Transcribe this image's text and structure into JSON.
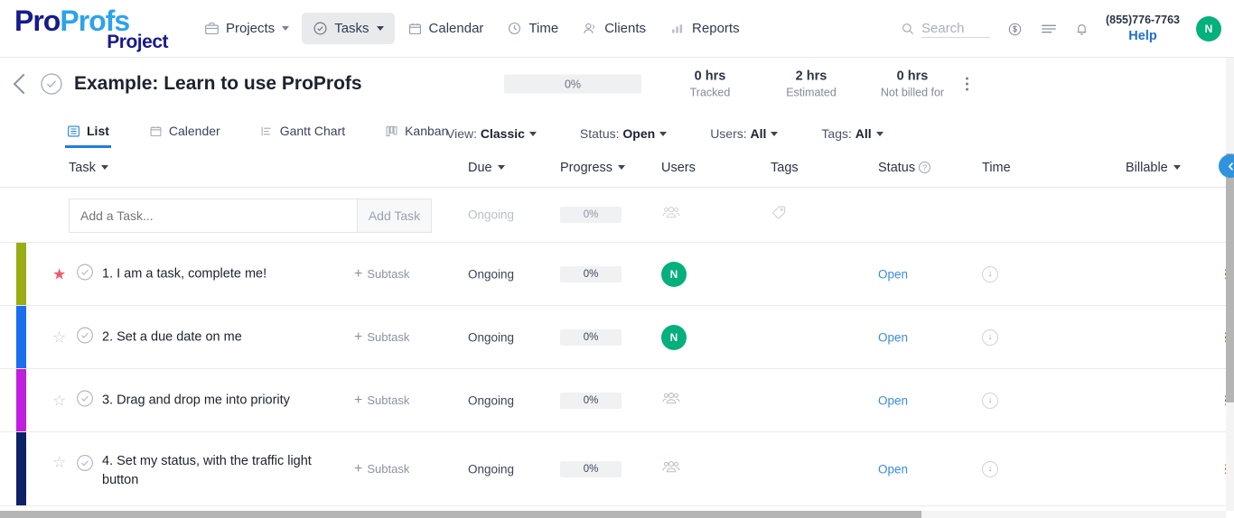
{
  "brand": {
    "logo_pro": "Pro",
    "logo_profs": "Profs",
    "logo_project": "Project",
    "accent_blue": "#2da3e8",
    "accent_navy": "#161b8c"
  },
  "topnav": {
    "items": [
      {
        "label": "Projects",
        "icon": "briefcase-icon",
        "has_caret": true,
        "active": false
      },
      {
        "label": "Tasks",
        "icon": "check-circle-icon",
        "has_caret": true,
        "active": true
      },
      {
        "label": "Calendar",
        "icon": "calendar-icon",
        "has_caret": false,
        "active": false
      },
      {
        "label": "Time",
        "icon": "clock-icon",
        "has_caret": false,
        "active": false
      },
      {
        "label": "Clients",
        "icon": "user-icon",
        "has_caret": false,
        "active": false
      },
      {
        "label": "Reports",
        "icon": "bar-chart-icon",
        "has_caret": false,
        "active": false
      }
    ],
    "search_placeholder": "Search",
    "billing_icon": "dollar-circle-icon",
    "menu_icon": "hamburger-icon",
    "bell_icon": "bell-icon",
    "help_phone": "(855)776-7763",
    "help_label": "Help",
    "avatar_initial": "N",
    "avatar_color": "#05b07c"
  },
  "project": {
    "back_icon": "back-chevron-icon",
    "status_icon": "check-circle-icon",
    "title": "Example: Learn to use ProProfs",
    "progress_label": "0%",
    "stats": [
      {
        "value": "0 hrs",
        "label": "Tracked"
      },
      {
        "value": "2 hrs",
        "label": "Estimated"
      },
      {
        "value": "0 hrs",
        "label": "Not billed for"
      }
    ],
    "more_icon": "kebab-menu-icon"
  },
  "view_tabs": [
    {
      "label": "List",
      "icon": "list-icon",
      "active": true
    },
    {
      "label": "Calender",
      "icon": "calendar-icon",
      "active": false
    },
    {
      "label": "Gantt Chart",
      "icon": "gantt-icon",
      "active": false
    },
    {
      "label": "Kanban",
      "icon": "kanban-icon",
      "active": false
    }
  ],
  "filters": [
    {
      "name": "View",
      "value": "Classic"
    },
    {
      "name": "Status",
      "value": "Open"
    },
    {
      "name": "Users",
      "value": "All"
    },
    {
      "name": "Tags",
      "value": "All"
    }
  ],
  "table": {
    "columns": [
      {
        "key": "task",
        "label": "Task",
        "sortable": true
      },
      {
        "key": "due",
        "label": "Due",
        "sortable": true
      },
      {
        "key": "progress",
        "label": "Progress",
        "sortable": true
      },
      {
        "key": "users",
        "label": "Users",
        "sortable": false
      },
      {
        "key": "tags",
        "label": "Tags",
        "sortable": false
      },
      {
        "key": "status",
        "label": "Status",
        "sortable": false,
        "help": true
      },
      {
        "key": "time",
        "label": "Time",
        "sortable": false
      },
      {
        "key": "billable",
        "label": "Billable",
        "sortable": true
      }
    ],
    "add_row": {
      "input_placeholder": "Add a Task...",
      "input_value": "",
      "button_label": "Add Task",
      "due": "Ongoing",
      "progress": "0%",
      "users_icon": "users-group-icon",
      "tags_icon": "tag-icon"
    },
    "rows": [
      {
        "bar_color": "#9aad14",
        "dot_color": "#7bcb18",
        "starred": true,
        "title": "1. I am a task, complete me!",
        "subtask_label": "Subtask",
        "due": "Ongoing",
        "progress": "0%",
        "user_avatar": "N",
        "tags": "",
        "status": "Open",
        "time_icon": "time-log-icon"
      },
      {
        "bar_color": "#1a6ef0",
        "dot_color": "#7bcb18",
        "starred": false,
        "title": "2. Set a due date on me",
        "subtask_label": "Subtask",
        "due": "Ongoing",
        "progress": "0%",
        "user_avatar": "N",
        "tags": "",
        "status": "Open",
        "time_icon": "time-log-icon"
      },
      {
        "bar_color": "#c01fe0",
        "dot_color": "#7bcb18",
        "starred": false,
        "title": "3. Drag and drop me into priority",
        "subtask_label": "Subtask",
        "due": "Ongoing",
        "progress": "0%",
        "user_avatar": "",
        "tags": "",
        "status": "Open",
        "time_icon": "time-log-icon"
      },
      {
        "bar_color": "#0d2266",
        "dot_color": "#7bcb18",
        "starred": false,
        "title": "4. Set my status, with the traffic light button",
        "subtask_label": "Subtask",
        "due": "Ongoing",
        "progress": "0%",
        "user_avatar": "",
        "tags": "",
        "status": "Open",
        "time_icon": "time-log-icon"
      }
    ],
    "collapse_button_icon": "chevron-left-circle-icon"
  }
}
